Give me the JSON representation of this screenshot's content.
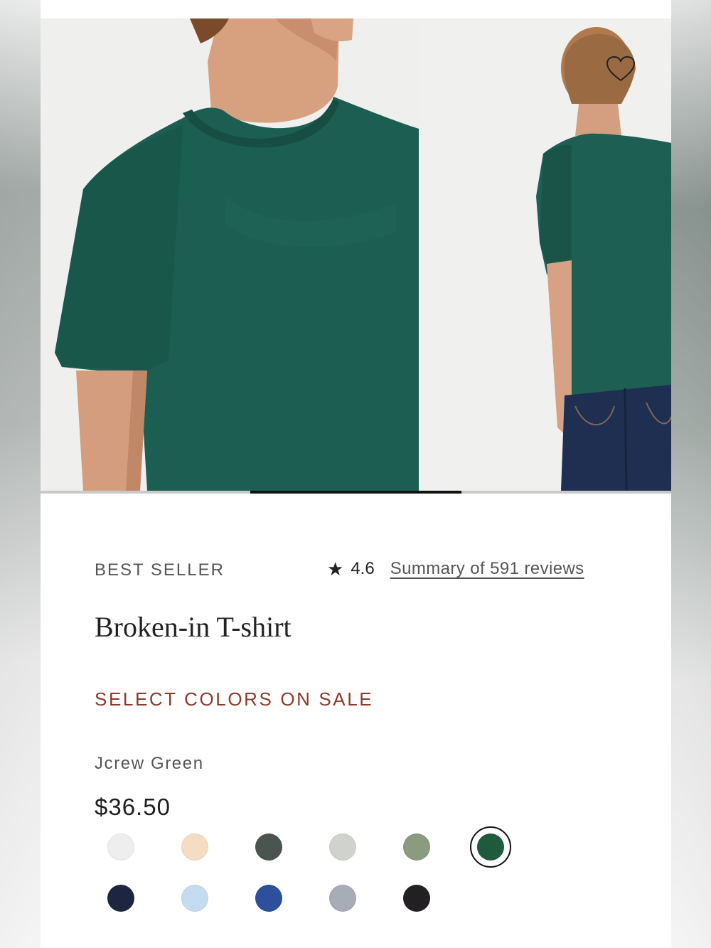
{
  "product": {
    "badge": "BEST SELLER",
    "rating": "4.6",
    "reviews_link": "Summary of 591 reviews",
    "title": "Broken-in T-shirt",
    "sale_note": "SELECT COLORS ON SALE",
    "selected_color": "Jcrew Green",
    "price": "$36.50"
  },
  "gallery": {
    "images": [
      "front-closeup",
      "back-view"
    ],
    "progress_start_fraction": 0.333,
    "progress_end_fraction": 0.667
  },
  "icons": {
    "favorite": "heart-icon",
    "rating": "star-icon"
  },
  "colors": {
    "swatches": [
      {
        "name": "white",
        "hex": "#eeeeee",
        "selected": false
      },
      {
        "name": "natural",
        "hex": "#f5ddc4",
        "selected": false
      },
      {
        "name": "charcoal",
        "hex": "#4b5550",
        "selected": false
      },
      {
        "name": "heather",
        "hex": "#d0d3cd",
        "selected": false
      },
      {
        "name": "sage",
        "hex": "#8a9b80",
        "selected": false
      },
      {
        "name": "jcrew-green",
        "hex": "#1f5a3c",
        "selected": true
      },
      {
        "name": "navy",
        "hex": "#1d2540",
        "selected": false
      },
      {
        "name": "light-blue",
        "hex": "#c5dcf0",
        "selected": false
      },
      {
        "name": "royal-blue",
        "hex": "#2d4f9c",
        "selected": false
      },
      {
        "name": "grey-blue",
        "hex": "#a6adb6",
        "selected": false
      },
      {
        "name": "black",
        "hex": "#232024",
        "selected": false
      }
    ],
    "accent_sale": "#8b3a2b",
    "shirt_green": "#1c5d52"
  }
}
